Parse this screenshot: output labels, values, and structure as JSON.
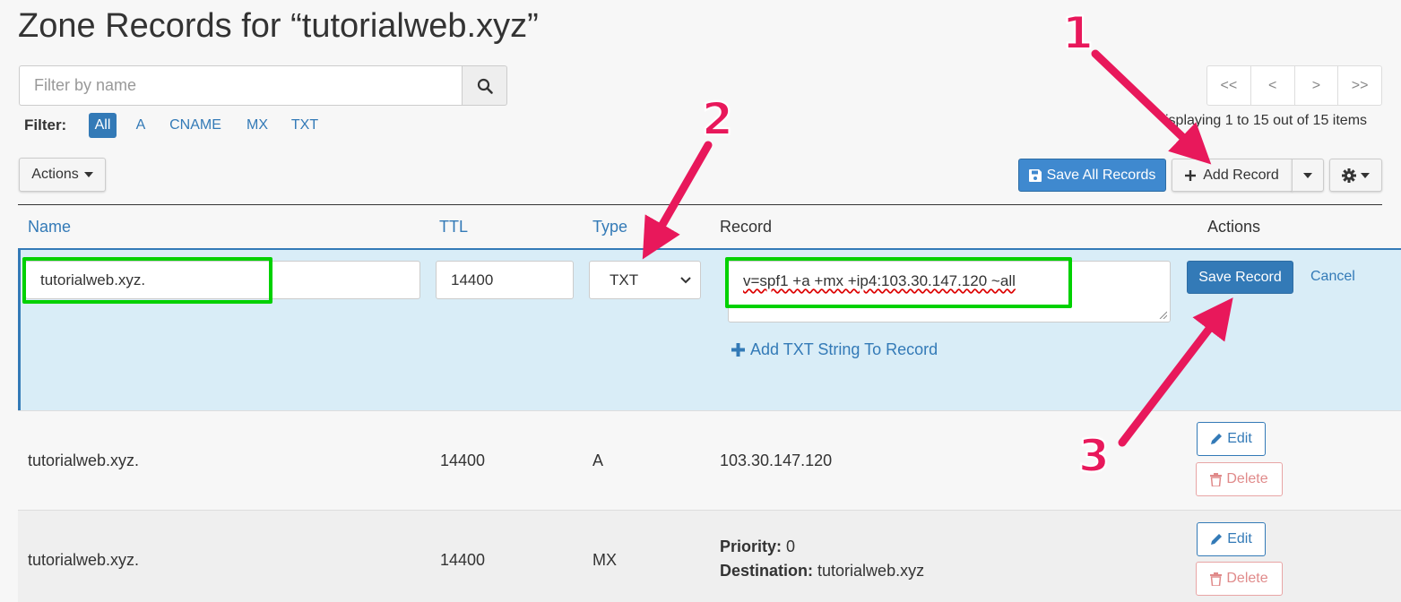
{
  "header": {
    "title": "Zone Records for “tutorialweb.xyz”"
  },
  "search": {
    "placeholder": "Filter by name",
    "value": ""
  },
  "filter": {
    "label": "Filter:",
    "options": [
      "All",
      "A",
      "CNAME",
      "MX",
      "TXT"
    ],
    "active": "All"
  },
  "pagination": {
    "buttons": [
      "<<",
      "<",
      ">",
      ">>"
    ],
    "info": "isplaying 1 to 15 out of 15 items"
  },
  "toolbar": {
    "actions_label": "Actions",
    "save_all_label": "Save All Records",
    "add_record_label": "Add Record"
  },
  "table": {
    "headers": {
      "name": "Name",
      "ttl": "TTL",
      "type": "Type",
      "record": "Record",
      "actions": "Actions"
    }
  },
  "edit_row": {
    "name_value": "tutorialweb.xyz.",
    "ttl_value": "14400",
    "type_value": "TXT",
    "record_value": "v=spf1 +a +mx +ip4:103.30.147.120 ~all",
    "add_string_label": "Add TXT String To Record",
    "save_label": "Save Record",
    "cancel_label": "Cancel"
  },
  "rows": [
    {
      "name": "tutorialweb.xyz.",
      "ttl": "14400",
      "type": "A",
      "record": "103.30.147.120",
      "edit_label": "Edit",
      "delete_label": "Delete"
    },
    {
      "name": "tutorialweb.xyz.",
      "ttl": "14400",
      "type": "MX",
      "priority_label": "Priority:",
      "priority_value": "0",
      "destination_label": "Destination:",
      "destination_value": "tutorialweb.xyz",
      "edit_label": "Edit",
      "delete_label": "Delete"
    }
  ],
  "annotations": {
    "labels": [
      "1",
      "2",
      "3"
    ],
    "color": "#e8185b",
    "highlight_color": "#00d100"
  },
  "colors": {
    "primary": "#337ab7",
    "edit_row_bg": "#d9edf7",
    "danger": "#e08a8a"
  },
  "icons": [
    "search-icon",
    "caret-down-icon",
    "save-icon",
    "plus-icon",
    "gear-icon",
    "chevron-down-icon",
    "pencil-icon",
    "trash-icon"
  ]
}
